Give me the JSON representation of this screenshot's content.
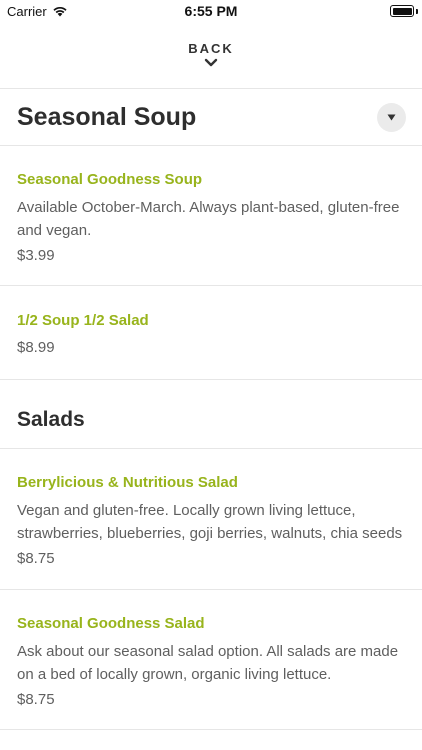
{
  "status_bar": {
    "carrier": "Carrier",
    "time": "6:55 PM",
    "wifi_icon": "wifi-icon",
    "battery_icon": "battery-icon"
  },
  "nav": {
    "back_label": "BACK",
    "chevron_icon": "chevron-down-icon"
  },
  "sections": [
    {
      "title": "Seasonal Soup",
      "toggle_icon": "caret-down-icon",
      "items": [
        {
          "name": "Seasonal Goodness Soup",
          "description": "Available October-March. Always plant-based, gluten-free and vegan.",
          "price": "$3.99"
        },
        {
          "name": "1/2 Soup 1/2 Salad",
          "price": "$8.99"
        }
      ]
    },
    {
      "title": "Salads",
      "items": [
        {
          "name": "Berrylicious & Nutritious Salad",
          "description": "Vegan and gluten-free. Locally grown living lettuce, strawberries, blueberries, goji berries, walnuts, chia seeds",
          "price": "$8.75"
        },
        {
          "name": "Seasonal Goodness Salad",
          "description": "Ask about our seasonal salad option. All salads are made on a bed of locally grown, organic living lettuce.",
          "price": "$8.75"
        }
      ]
    }
  ],
  "colors": {
    "accent": "#98b41c",
    "text": "#333333",
    "muted_text": "#5f5f5f",
    "divider": "#e6e6e6"
  }
}
